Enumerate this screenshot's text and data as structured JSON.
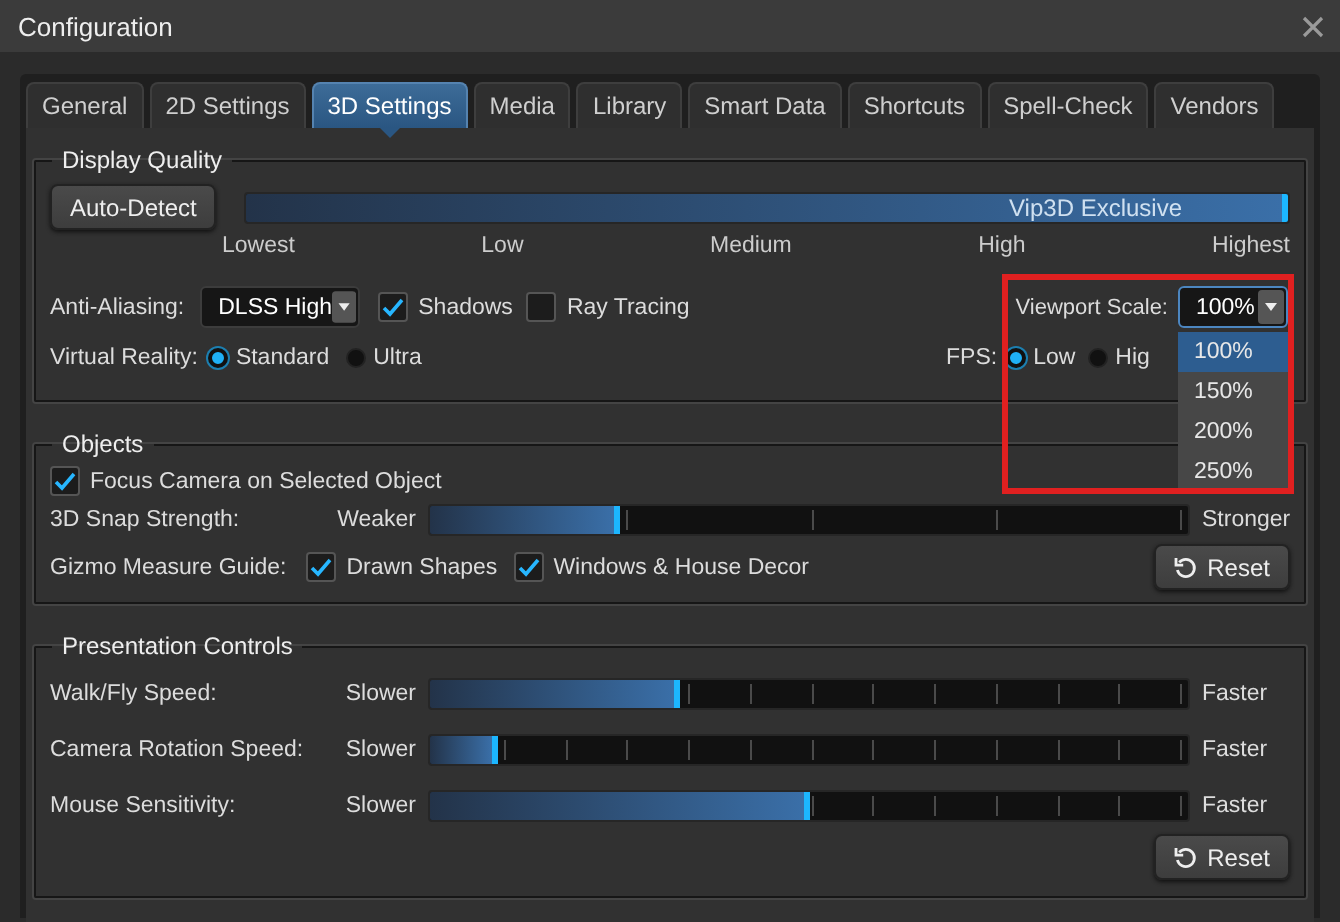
{
  "window": {
    "title": "Configuration"
  },
  "tabs": [
    {
      "label": "General",
      "selected": false
    },
    {
      "label": "2D Settings",
      "selected": false
    },
    {
      "label": "3D Settings",
      "selected": true
    },
    {
      "label": "Media",
      "selected": false
    },
    {
      "label": "Library",
      "selected": false
    },
    {
      "label": "Smart Data",
      "selected": false
    },
    {
      "label": "Shortcuts",
      "selected": false
    },
    {
      "label": "Spell-Check",
      "selected": false
    },
    {
      "label": "Vendors",
      "selected": false
    }
  ],
  "display_quality": {
    "title": "Display Quality",
    "auto_detect": "Auto-Detect",
    "quality": {
      "level": 1,
      "caption": "Vip3D Exclusive",
      "marks": [
        "Lowest",
        "Low",
        "Medium",
        "High",
        "Highest"
      ]
    },
    "anti_aliasing": {
      "label": "Anti-Aliasing:",
      "value": "DLSS High"
    },
    "checks": [
      {
        "label": "Shadows",
        "checked": true
      },
      {
        "label": "Ray Tracing",
        "checked": false
      }
    ],
    "viewport_scale": {
      "label": "Viewport Scale:",
      "value": "100%",
      "expanded": true,
      "options": [
        {
          "label": "100%",
          "selected": true
        },
        {
          "label": "150%",
          "selected": false
        },
        {
          "label": "200%",
          "selected": false
        },
        {
          "label": "250%",
          "selected": false
        }
      ]
    },
    "virtual_reality": {
      "label": "Virtual Reality:",
      "options": [
        {
          "label": "Standard",
          "selected": true
        },
        {
          "label": "Ultra",
          "selected": false
        }
      ]
    },
    "fps": {
      "label": "FPS:",
      "options": [
        {
          "label": "Low",
          "selected": true
        },
        {
          "label": "Hig",
          "selected": false
        }
      ]
    }
  },
  "objects": {
    "title": "Objects",
    "focus_camera": {
      "label": "Focus Camera on Selected Object",
      "checked": true
    },
    "snap": {
      "label": "3D Snap Strength:",
      "min": "Weaker",
      "max": "Stronger",
      "level": 0.25
    },
    "gizmo": {
      "label": "Gizmo Measure Guide:",
      "checks": [
        {
          "label": "Drawn Shapes",
          "checked": true
        },
        {
          "label": "Windows & House Decor",
          "checked": true
        }
      ]
    },
    "reset": "Reset"
  },
  "presentation": {
    "title": "Presentation Controls",
    "sliders": [
      {
        "label": "Walk/Fly Speed:",
        "min": "Slower",
        "max": "Faster",
        "level": 0.33
      },
      {
        "label": "Camera Rotation Speed:",
        "min": "Slower",
        "max": "Faster",
        "level": 0.09
      },
      {
        "label": "Mouse Sensitivity:",
        "min": "Slower",
        "max": "Faster",
        "level": 0.5
      }
    ],
    "reset": "Reset"
  },
  "annotation": {
    "kind": "highlight"
  }
}
